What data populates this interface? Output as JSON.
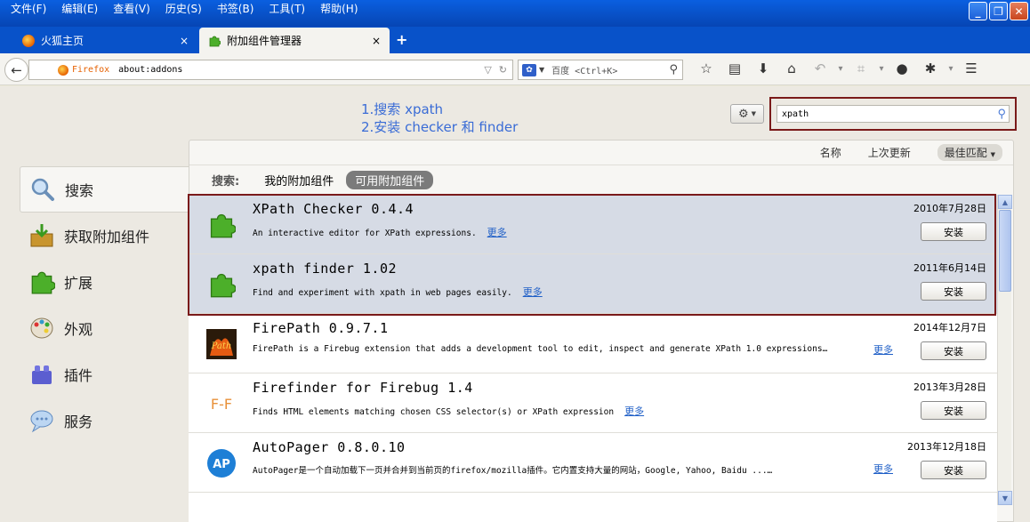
{
  "menu": [
    "文件(F)",
    "编辑(E)",
    "查看(V)",
    "历史(S)",
    "书签(B)",
    "工具(T)",
    "帮助(H)"
  ],
  "window_controls": {
    "minimize": "_",
    "restore": "❐",
    "close": "✕"
  },
  "tabs": [
    {
      "label": "火狐主页",
      "close": "×"
    },
    {
      "label": "附加组件管理器",
      "close": "×"
    }
  ],
  "new_tab": "+",
  "nav": {
    "back": "←",
    "brand": "Firefox",
    "url": "about:addons",
    "search_engine": "百度",
    "search_placeholder": "百度 <Ctrl+K>"
  },
  "annotation": {
    "line1": "1.搜索 xpath",
    "line2": "2.安装 checker 和 finder"
  },
  "addon_search": {
    "value": "xpath"
  },
  "categories": [
    {
      "label": "搜索",
      "icon": "magnifier-icon"
    },
    {
      "label": "获取附加组件",
      "icon": "download-box-icon"
    },
    {
      "label": "扩展",
      "icon": "puzzle-icon"
    },
    {
      "label": "外观",
      "icon": "palette-icon"
    },
    {
      "label": "插件",
      "icon": "lego-brick-icon"
    },
    {
      "label": "服务",
      "icon": "speech-bubble-icon"
    }
  ],
  "sort": {
    "name": "名称",
    "last_updated": "上次更新",
    "best_match": "最佳匹配"
  },
  "filter": {
    "label": "搜索:",
    "my_addons": "我的附加组件",
    "available_addons": "可用附加组件"
  },
  "results": [
    {
      "name": "XPath Checker 0.4.4",
      "desc": "An interactive editor for XPath expressions.",
      "more": "更多",
      "date": "2010年7月28日",
      "install": "安装"
    },
    {
      "name": "xpath finder 1.02",
      "desc": "Find and experiment with xpath in web pages easily.",
      "more": "更多",
      "date": "2011年6月14日",
      "install": "安装"
    },
    {
      "name": "FirePath 0.9.7.1",
      "desc": "FirePath is a Firebug extension that adds a development tool to edit, inspect and generate XPath 1.0 expressions…",
      "more": "更多",
      "date": "2014年12月7日",
      "install": "安装"
    },
    {
      "name": "Firefinder for Firebug 1.4",
      "desc": "Finds HTML elements matching chosen CSS selector(s) or XPath expression",
      "more": "更多",
      "date": "2013年3月28日",
      "install": "安装"
    },
    {
      "name": "AutoPager 0.8.0.10",
      "desc": "AutoPager是一个自动加载下一页并合并到当前页的firefox/mozilla插件。它内置支持大量的网站，Google, Yahoo, Baidu ...…",
      "more": "更多",
      "date": "2013年12月18日",
      "install": "安装"
    }
  ],
  "colors": {
    "title_blue": "#0852c9",
    "highlight_frame": "#7a1a1a",
    "annotation_blue": "#3a6cd6",
    "link_blue": "#1f5fc7"
  }
}
